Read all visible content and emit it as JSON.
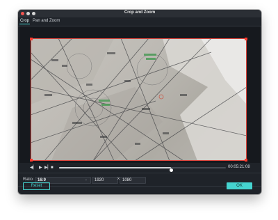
{
  "window": {
    "title": "Crop and Zoom"
  },
  "tabs": [
    {
      "label": "Crop",
      "active": true
    },
    {
      "label": "Pan and Zoom",
      "active": false
    }
  ],
  "player": {
    "controls": [
      "step-back-icon",
      "play-icon",
      "step-forward-icon",
      "stop-icon"
    ],
    "timecode": "00:05:21:08",
    "progress": 0.67
  },
  "ratio": {
    "label": "Ratio:",
    "selected": "16:9"
  },
  "size": {
    "width": "1920",
    "times": "x",
    "height": "1080"
  },
  "buttons": {
    "reset": "Reset",
    "ok": "OK"
  },
  "colors": {
    "accent": "#45d4d0",
    "crop_border": "#e2473e",
    "background": "#1f2329"
  }
}
